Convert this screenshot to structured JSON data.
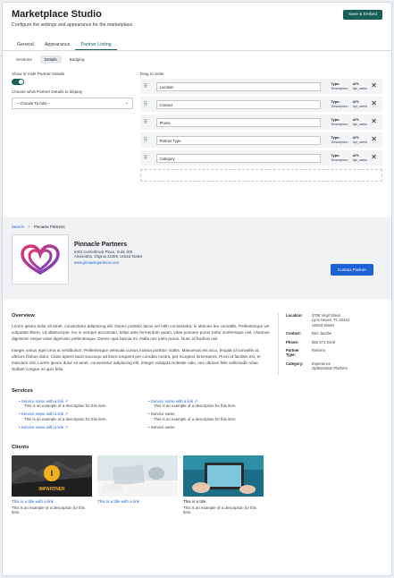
{
  "header": {
    "title": "Marketplace Studio",
    "subtitle": "Configure the settings and appearance for the marketplace.",
    "save_label": "Save & Embed"
  },
  "tabs": [
    "General",
    "Appearance",
    "Partner Listing"
  ],
  "subtabs": [
    "Sections",
    "Details",
    "Badging"
  ],
  "settings": {
    "toggle_label": "Show or Hide Partner Details",
    "toggle_on": true,
    "choose_label": "Choose what Partner Details to display",
    "choose_value": "-- Choose To Add --",
    "drag_label": "Drag to order",
    "rows": [
      {
        "field": "Location",
        "type_label": "Type:",
        "type_value": "Description",
        "api_label": "API:",
        "api_value": "api_name"
      },
      {
        "field": "Contact",
        "type_label": "Type:",
        "type_value": "Description",
        "api_label": "API:",
        "api_value": "api_name"
      },
      {
        "field": "Phone",
        "type_label": "Type:",
        "type_value": "Description",
        "api_label": "API:",
        "api_value": "api_name"
      },
      {
        "field": "Partner Type",
        "type_label": "Type:",
        "type_value": "Description",
        "api_label": "API:",
        "api_value": "api_name"
      },
      {
        "field": "Category",
        "type_label": "Type:",
        "type_value": "Description",
        "api_label": "API:",
        "api_value": "api_name"
      }
    ]
  },
  "preview": {
    "breadcrumb_root": "Search",
    "breadcrumb_sep": ">",
    "breadcrumb_current": "Pinnacle Partners",
    "partner_name": "Pinnacle Partners",
    "address_line1": "8302 Centerbrook Place, Suite 300",
    "address_line2": "Alexandria, Virginia 22308, United States",
    "website": "www.pinnaclepartners.com",
    "contact_label": "Contact Partner",
    "overview_title": "Overview",
    "overview_p1": "Lorem ipsum dolor sit amet, consectetur adipiscing elit. Donec porttitor lacus vel nibh consectetur, in ultricies leo convallis. Pellentesque vel vulputate libero. Ut ullamcorper, leo in semper accumsan, tellus ante fermentum quam, vitae posuere purus tortor scelerisque nisl. Vivamus dignissim neque vitae dignissim pellentesque. Donec quis lacinia mi. Nulla nec justo purus. Nunc id facilisis nisi.",
    "overview_p2": "Integer varius eget urna ut vestibulum. Pellentesque vehicula cursus massa porttitor mattis. Maecenas est arcu, feugiat id convallis at, ultrices finibus dolor. Class aptent taciti sociosqu ad litora torquent per conubia nostra, per inceptos himenaeos. Proin id facilisis est, et interdum nisl. Lorem ipsum dolor sit amet, consectetur adipiscing elit. Integer volutpat molestie odio, nec ultrices felis sollicitudin vitae. Nullam congue mi quis felis.",
    "facts": [
      {
        "k": "Location:",
        "v1": "3706 Virgil Street",
        "v2": "Lynn Haven, FL 32444",
        "v3": "United States"
      },
      {
        "k": "Contact:",
        "v1": "Ben Jacobs"
      },
      {
        "k": "Phone:",
        "v1": "850-271-2449"
      },
      {
        "k1": "Partner",
        "k2": "Type:",
        "v1": "Referrer"
      },
      {
        "k": "Category:",
        "v1": "Experience",
        "v2": "Optimization Platform"
      }
    ],
    "services_title": "Services",
    "services": [
      {
        "name": "Service name with a link",
        "desc": "This is an example of a description for this item.",
        "link": true
      },
      {
        "name": "Service name with a link",
        "desc": "This is an example of a description for this item.",
        "link": true
      },
      {
        "name": "Service name with a link",
        "desc": "This is an example of a description for this item.",
        "link": true
      },
      {
        "name": "Service name",
        "desc": "This is an example of a description for this item.",
        "link": false
      },
      {
        "name": "Service name with a link",
        "desc": "",
        "link": true
      },
      {
        "name": "Service name",
        "desc": "",
        "link": false
      }
    ],
    "clients_title": "Clients",
    "clients": [
      {
        "title": "This is a title with a link",
        "desc": "This is an example of a description for this item.",
        "link": true,
        "badge_text": "IMPARTNER"
      },
      {
        "title": "This is a title with a link",
        "desc": "",
        "link": true
      },
      {
        "title": "This is a title",
        "desc": "This is an example of a description for this item.",
        "link": false
      }
    ]
  },
  "colors": {
    "brand_dark_green": "#155f57",
    "link_blue": "#1d62d6",
    "logo_gradient_start": "#e2356a",
    "logo_gradient_end": "#6d43c9"
  }
}
